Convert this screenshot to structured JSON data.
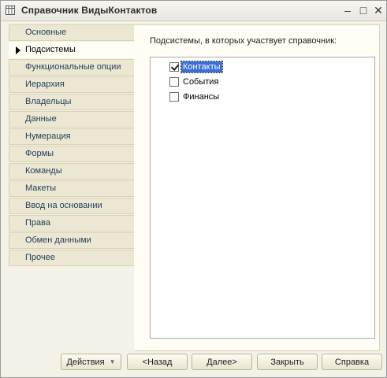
{
  "window": {
    "title": "Справочник ВидыКонтактов",
    "icon": "table-icon",
    "controls": {
      "minimize": "–",
      "maximize": "□",
      "close": "✕"
    }
  },
  "nav": {
    "items": [
      {
        "label": "Основные",
        "active": false
      },
      {
        "label": "Подсистемы",
        "active": true
      },
      {
        "label": "Функциональные опции",
        "active": false
      },
      {
        "label": "Иерархия",
        "active": false
      },
      {
        "label": "Владельцы",
        "active": false
      },
      {
        "label": "Данные",
        "active": false
      },
      {
        "label": "Нумерация",
        "active": false
      },
      {
        "label": "Формы",
        "active": false
      },
      {
        "label": "Команды",
        "active": false
      },
      {
        "label": "Макеты",
        "active": false
      },
      {
        "label": "Ввод на основании",
        "active": false
      },
      {
        "label": "Права",
        "active": false
      },
      {
        "label": "Обмен данными",
        "active": false
      },
      {
        "label": "Прочее",
        "active": false
      }
    ]
  },
  "panel": {
    "label": "Подсистемы, в которых участвует справочник:",
    "subsystems": [
      {
        "label": "Контакты",
        "checked": true,
        "selected": true
      },
      {
        "label": "События",
        "checked": false,
        "selected": false
      },
      {
        "label": "Финансы",
        "checked": false,
        "selected": false
      }
    ]
  },
  "footer": {
    "actions": "Действия",
    "back": "<Назад",
    "next": "Далее>",
    "close": "Закрыть",
    "help": "Справка"
  }
}
